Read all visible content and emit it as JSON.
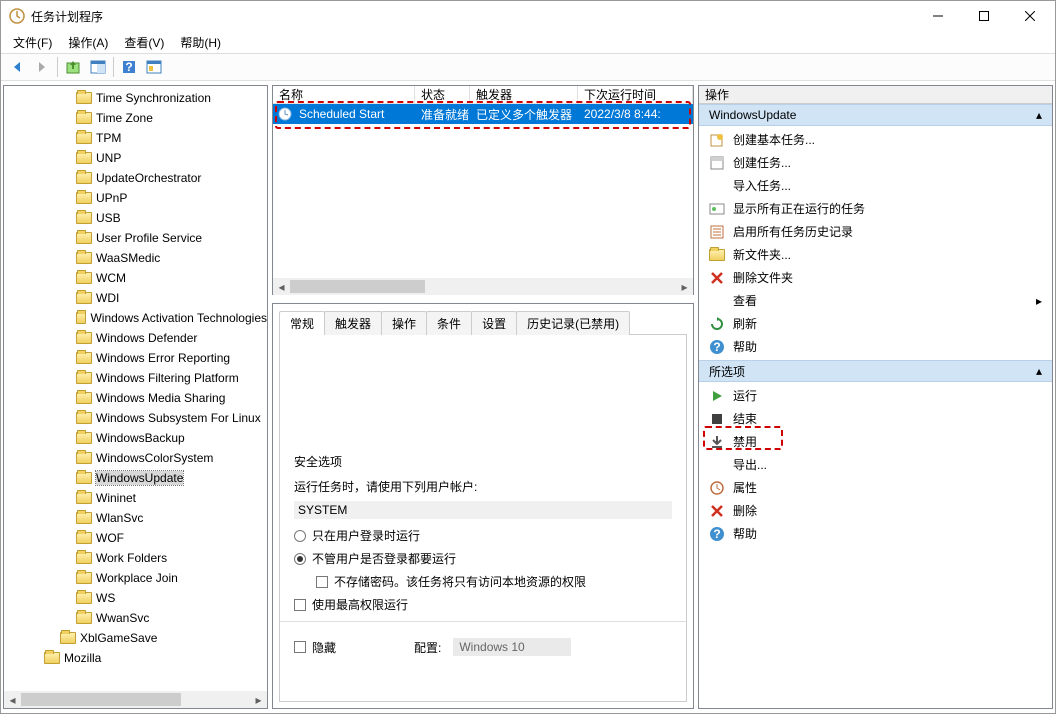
{
  "window": {
    "title": "任务计划程序"
  },
  "menu": {
    "file": "文件(F)",
    "action": "操作(A)",
    "view": "查看(V)",
    "help": "帮助(H)"
  },
  "tree": {
    "items": [
      "Time Synchronization",
      "Time Zone",
      "TPM",
      "UNP",
      "UpdateOrchestrator",
      "UPnP",
      "USB",
      "User Profile Service",
      "WaaSMedic",
      "WCM",
      "WDI",
      "Windows Activation Technologies",
      "Windows Defender",
      "Windows Error Reporting",
      "Windows Filtering Platform",
      "Windows Media Sharing",
      "Windows Subsystem For Linux",
      "WindowsBackup",
      "WindowsColorSystem",
      "WindowsUpdate",
      "Wininet",
      "WlanSvc",
      "WOF",
      "Work Folders",
      "Workplace Join",
      "WS",
      "WwanSvc"
    ],
    "parent1": "XblGameSave",
    "parent0": "Mozilla",
    "selected": "WindowsUpdate"
  },
  "task_columns": {
    "name": "名称",
    "status": "状态",
    "trigger": "触发器",
    "next_run": "下次运行时间"
  },
  "task": {
    "name": "Scheduled Start",
    "status": "准备就绪",
    "trigger": "已定义多个触发器",
    "next_run": "2022/3/8 8:44:"
  },
  "tabs": {
    "general": "常规",
    "triggers": "触发器",
    "actions": "操作",
    "conditions": "条件",
    "settings": "设置",
    "history": "历史记录(已禁用)"
  },
  "security": {
    "title": "安全选项",
    "run_as": "运行任务时，请使用下列用户帐户:",
    "account": "SYSTEM",
    "only_logged_on": "只在用户登录时运行",
    "whether_logged": "不管用户是否登录都要运行",
    "no_store_pwd": "不存储密码。该任务将只有访问本地资源的权限",
    "highest_priv": "使用最高权限运行",
    "hidden": "隐藏",
    "config_label": "配置:",
    "config_value": "Windows 10"
  },
  "actions_pane": {
    "header": "操作",
    "section1": "WindowsUpdate",
    "items1": {
      "create_basic": "创建基本任务...",
      "create": "创建任务...",
      "import": "导入任务...",
      "show_running": "显示所有正在运行的任务",
      "enable_history": "启用所有任务历史记录",
      "new_folder": "新文件夹...",
      "delete_folder": "删除文件夹",
      "view": "查看",
      "refresh": "刷新",
      "help": "帮助"
    },
    "section2": "所选项",
    "items2": {
      "run": "运行",
      "end": "结束",
      "disable": "禁用",
      "export": "导出...",
      "properties": "属性",
      "delete": "删除",
      "help": "帮助"
    }
  }
}
